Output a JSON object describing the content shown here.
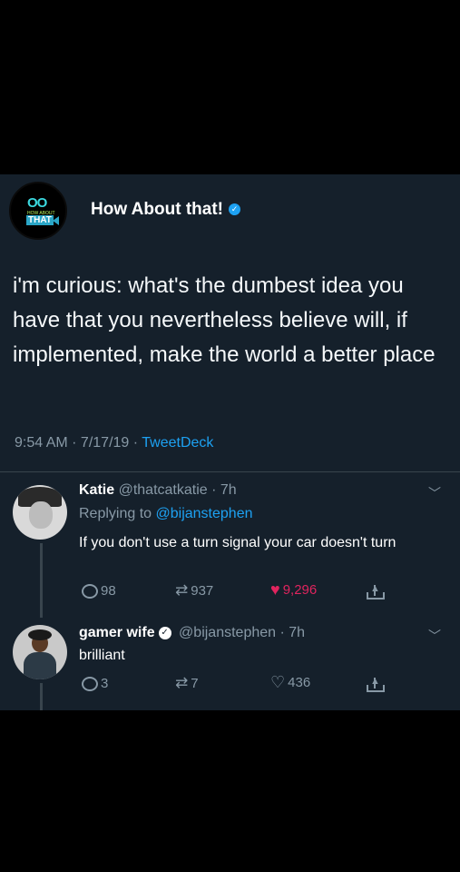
{
  "tweet": {
    "author": "How About that!",
    "logo_text": {
      "top": "OO",
      "middle": "HOW ABOUT",
      "bottom": "THAT"
    },
    "text": "i'm curious: what's the dumbest idea you have that you nevertheless believe will, if implemented, make the world a better place",
    "time": "9:54 AM",
    "date": "7/17/19",
    "source": "TweetDeck"
  },
  "replies": [
    {
      "name": "Katie",
      "handle": "@thatcatkatie",
      "age": "7h",
      "replying_label": "Replying to",
      "replying_handle": "@bijanstephen",
      "text": "If you don't use a turn signal your car doesn't turn",
      "replies": "98",
      "retweets": "937",
      "likes": "9,296",
      "liked": true
    },
    {
      "name": "gamer wife",
      "handle": "@bijanstephen",
      "age": "7h",
      "text": "brilliant",
      "replies": "3",
      "retweets": "7",
      "likes": "436",
      "liked": false
    }
  ],
  "colors": {
    "background": "#15202b",
    "accent": "#1da1f2",
    "like": "#e0245e",
    "muted": "#8899a6"
  }
}
